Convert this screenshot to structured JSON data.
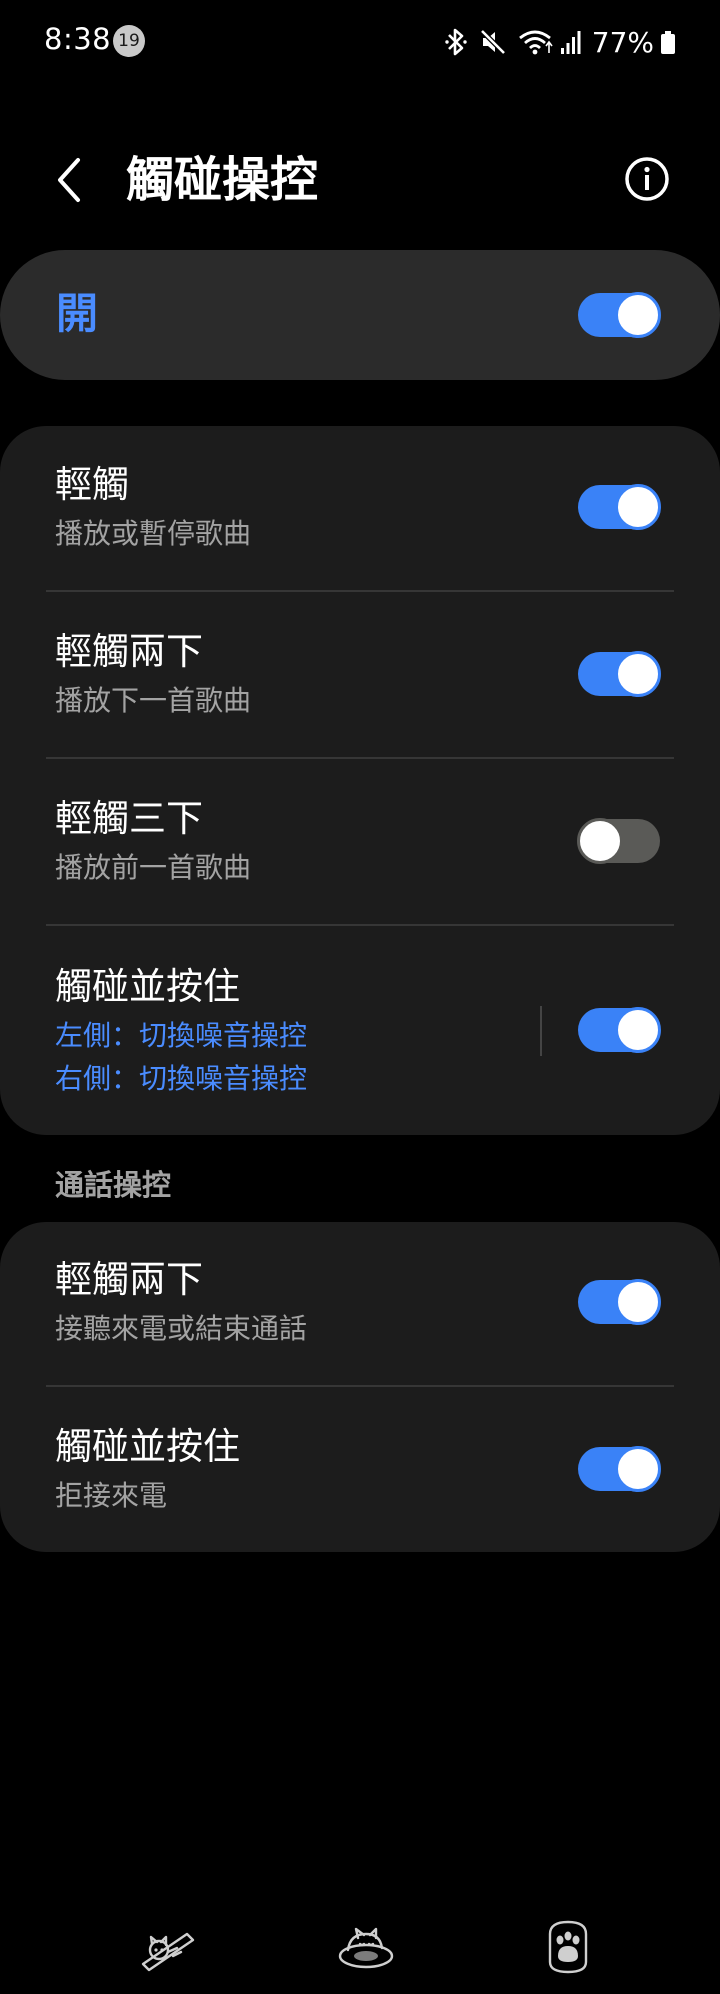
{
  "status_bar": {
    "time": "8:38",
    "notification_count": "19",
    "battery_percent": "77%"
  },
  "header": {
    "title": "觸碰操控"
  },
  "master": {
    "label": "開",
    "enabled": true
  },
  "touch_controls": [
    {
      "title": "輕觸",
      "subtitle": "播放或暫停歌曲",
      "enabled": true
    },
    {
      "title": "輕觸兩下",
      "subtitle": "播放下一首歌曲",
      "enabled": true
    },
    {
      "title": "輕觸三下",
      "subtitle": "播放前一首歌曲",
      "enabled": false
    },
    {
      "title": "觸碰並按住",
      "subtitle_left": "左側：切換噪音操控",
      "subtitle_right": "右側：切換噪音操控",
      "enabled": true
    }
  ],
  "call_controls": {
    "header": "通話操控",
    "items": [
      {
        "title": "輕觸兩下",
        "subtitle": "接聽來電或結束通話",
        "enabled": true
      },
      {
        "title": "觸碰並按住",
        "subtitle": "拒接來電",
        "enabled": true
      }
    ]
  },
  "colors": {
    "accent": "#3a82f7",
    "accent_text": "#4a8cff",
    "background": "#000000",
    "card": "#1c1c1c",
    "master_card": "#2b2b2b"
  },
  "icons": {
    "back": "back-arrow-icon",
    "info": "info-icon",
    "bluetooth": "bluetooth-icon",
    "mute": "mute-icon",
    "wifi": "wifi-icon",
    "signal": "signal-icon",
    "battery": "battery-icon",
    "nav": [
      "cat-sliding-icon",
      "cat-sleeping-icon",
      "paw-icon"
    ]
  }
}
